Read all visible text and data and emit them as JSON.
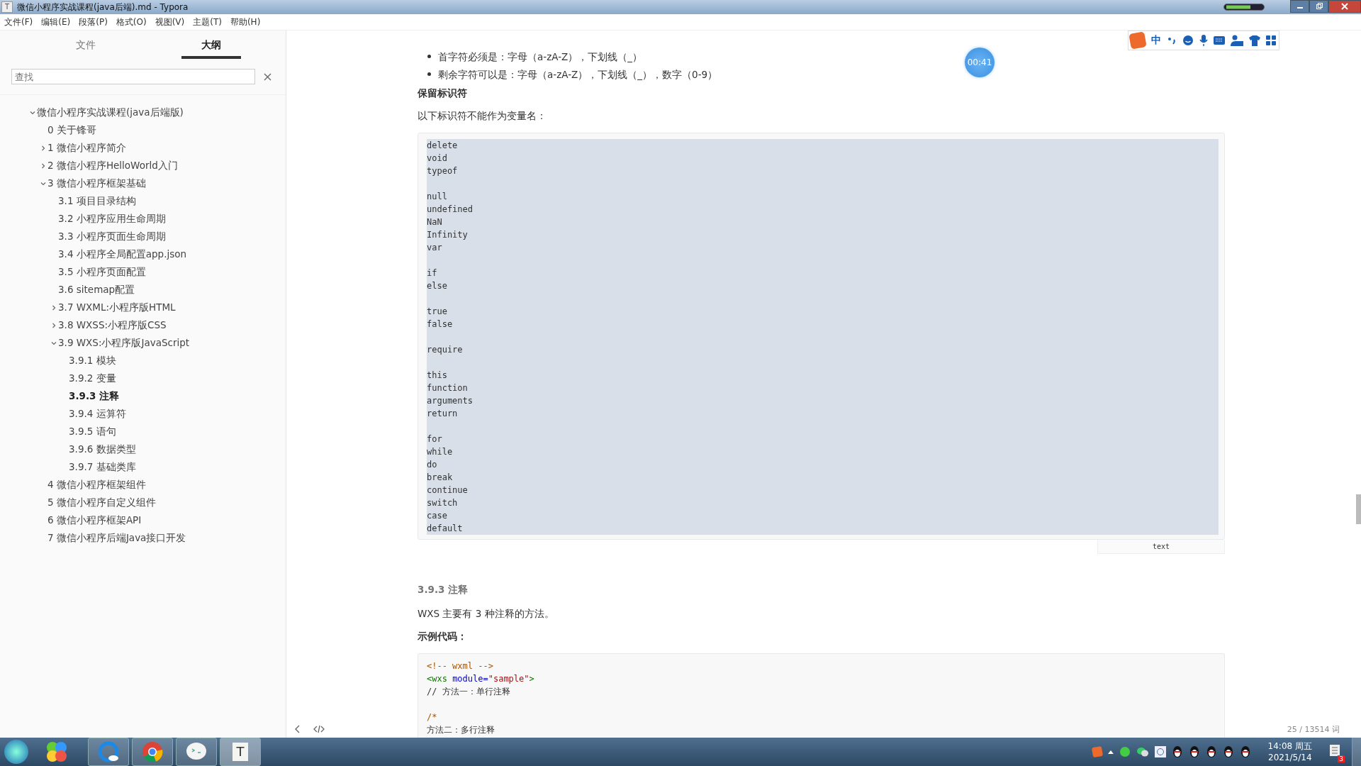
{
  "window": {
    "title": "微信小程序实战课程(java后端).md - Typora",
    "icon_letter": "T"
  },
  "taskbar_app_letter": "T",
  "menu": [
    "文件(F)",
    "编辑(E)",
    "段落(P)",
    "格式(O)",
    "视图(V)",
    "主题(T)",
    "帮助(H)"
  ],
  "ime_toolbar": {
    "mode": "中"
  },
  "sidebar": {
    "tabs": [
      {
        "label": "文件",
        "selected": false
      },
      {
        "label": "大纲",
        "selected": true
      }
    ],
    "search": {
      "placeholder": "查找"
    },
    "outline": [
      {
        "label": "微信小程序实战课程(java后端版)",
        "selected": false,
        "expanded": true,
        "children": [
          {
            "label": "0 关于锋哥",
            "selected": false
          },
          {
            "label": "1 微信小程序简介",
            "selected": false,
            "expanded": false
          },
          {
            "label": "2 微信小程序HelloWorld入门",
            "selected": false,
            "expanded": false
          },
          {
            "label": "3 微信小程序框架基础",
            "selected": false,
            "expanded": true,
            "children": [
              {
                "label": "3.1 项目目录结构",
                "selected": false
              },
              {
                "label": "3.2 小程序应用生命周期",
                "selected": false
              },
              {
                "label": "3.3 小程序页面生命周期",
                "selected": false
              },
              {
                "label": "3.4 小程序全局配置app.json",
                "selected": false
              },
              {
                "label": "3.5 小程序页面配置",
                "selected": false
              },
              {
                "label": "3.6 sitemap配置",
                "selected": false
              },
              {
                "label": "3.7 WXML:小程序版HTML",
                "selected": false,
                "expanded": false
              },
              {
                "label": "3.8 WXSS:小程序版CSS",
                "selected": false,
                "expanded": false
              },
              {
                "label": "3.9 WXS:小程序版JavaScript",
                "selected": false,
                "expanded": true,
                "children": [
                  {
                    "label": "3.9.1 模块",
                    "selected": false
                  },
                  {
                    "label": "3.9.2 变量",
                    "selected": false
                  },
                  {
                    "label": "3.9.3 注释",
                    "selected": true
                  },
                  {
                    "label": "3.9.4 运算符",
                    "selected": false
                  },
                  {
                    "label": "3.9.5 语句",
                    "selected": false
                  },
                  {
                    "label": "3.9.6 数据类型",
                    "selected": false
                  },
                  {
                    "label": "3.9.7 基础类库",
                    "selected": false
                  }
                ]
              }
            ]
          },
          {
            "label": "4 微信小程序框架组件",
            "selected": false
          },
          {
            "label": "5 微信小程序自定义组件",
            "selected": false
          },
          {
            "label": "6 微信小程序框架API",
            "selected": false
          },
          {
            "label": "7 微信小程序后端Java接口开发",
            "selected": false
          }
        ]
      }
    ]
  },
  "document": [
    {
      "kind": "bullets",
      "items": [
        "首字符必须是：字母（a-zA-Z），下划线（_）",
        "剩余字符可以是：字母（a-zA-Z），下划线（_），数字（0-9）"
      ]
    },
    {
      "kind": "strong",
      "text": "保留标识符"
    },
    {
      "kind": "paragraph",
      "text": "以下标识符不能作为变量名："
    },
    {
      "kind": "code",
      "selected": true,
      "language": "text",
      "groups": [
        [
          [
            {
              "text": "delete",
              "kind": "plain"
            }
          ],
          [
            {
              "text": "void",
              "kind": "plain"
            }
          ],
          [
            {
              "text": "typeof",
              "kind": "plain"
            }
          ]
        ],
        [
          [
            {
              "text": "null",
              "kind": "plain"
            }
          ],
          [
            {
              "text": "undefined",
              "kind": "plain"
            }
          ],
          [
            {
              "text": "NaN",
              "kind": "plain"
            }
          ],
          [
            {
              "text": "Infinity",
              "kind": "plain"
            }
          ],
          [
            {
              "text": "var",
              "kind": "plain"
            }
          ]
        ],
        [
          [
            {
              "text": "if",
              "kind": "plain"
            }
          ],
          [
            {
              "text": "else",
              "kind": "plain"
            }
          ]
        ],
        [
          [
            {
              "text": "true",
              "kind": "plain"
            }
          ],
          [
            {
              "text": "false",
              "kind": "plain"
            }
          ]
        ],
        [
          [
            {
              "text": "require",
              "kind": "plain"
            }
          ]
        ],
        [
          [
            {
              "text": "this",
              "kind": "plain"
            }
          ],
          [
            {
              "text": "function",
              "kind": "plain"
            }
          ],
          [
            {
              "text": "arguments",
              "kind": "plain"
            }
          ],
          [
            {
              "text": "return",
              "kind": "plain"
            }
          ]
        ],
        [
          [
            {
              "text": "for",
              "kind": "plain"
            }
          ],
          [
            {
              "text": "while",
              "kind": "plain"
            }
          ],
          [
            {
              "text": "do",
              "kind": "plain"
            }
          ],
          [
            {
              "text": "break",
              "kind": "plain"
            }
          ],
          [
            {
              "text": "continue",
              "kind": "plain"
            }
          ],
          [
            {
              "text": "switch",
              "kind": "plain"
            }
          ],
          [
            {
              "text": "case",
              "kind": "plain"
            }
          ],
          [
            {
              "text": "default",
              "kind": "plain"
            }
          ]
        ]
      ]
    },
    {
      "kind": "heading",
      "text": "3.9.3 注释"
    },
    {
      "kind": "paragraph",
      "text": "WXS 主要有 3 种注释的方法。"
    },
    {
      "kind": "strong",
      "text": "示例代码："
    },
    {
      "kind": "code",
      "selected": false,
      "groups": [
        [
          [
            {
              "text": "<!-- wxml -->",
              "kind": "comment"
            }
          ],
          [
            {
              "text": "<wxs",
              "kind": "tag"
            },
            {
              "text": " module=",
              "kind": "attr"
            },
            {
              "text": "\"sample\"",
              "kind": "string"
            },
            {
              "text": ">",
              "kind": "tag"
            }
          ],
          [
            {
              "text": "// 方法一：单行注释",
              "kind": "plain"
            }
          ]
        ],
        [
          [
            {
              "text": "/*",
              "kind": "comment"
            }
          ],
          [
            {
              "text": "方法二：多行注释",
              "kind": "plain"
            }
          ]
        ]
      ]
    }
  ],
  "timer": "00:41",
  "word_count": "25 / 13514 词",
  "clock": {
    "time": "14:08 周五",
    "date": "2021/5/14"
  },
  "notification_count": "3"
}
